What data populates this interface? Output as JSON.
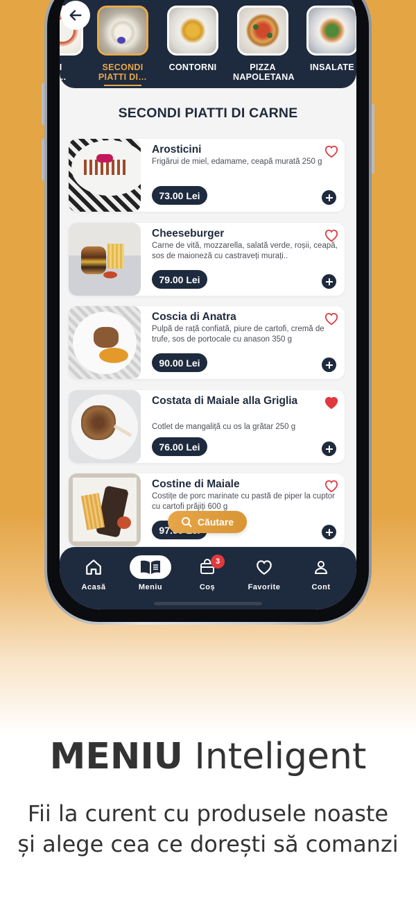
{
  "categories": [
    {
      "label": "DI\nDI…",
      "active": false
    },
    {
      "label": "SECONDI\nPIATTI DI…",
      "active": true
    },
    {
      "label": "CONTORNI",
      "active": false
    },
    {
      "label": "PIZZA\nNAPOLETANA",
      "active": false
    },
    {
      "label": "INSALATE",
      "active": false
    }
  ],
  "section_title": "SECONDI PIATTI DI CARNE",
  "products": [
    {
      "name": "Arosticini",
      "desc": "Frigărui de miel, edamame, ceapă murată 250 g",
      "price": "73.00 Lei",
      "favorite": false
    },
    {
      "name": "Cheeseburger",
      "desc": "Carne de vită, mozzarella, salată verde, roșii, ceapă, sos de maioneză cu castraveți murați..",
      "price": "79.00 Lei",
      "favorite": false
    },
    {
      "name": "Coscia di Anatra",
      "desc": "Pulpă de rață confiată, piure de cartofi, cremă de trufe, sos de portocale cu anason 350 g",
      "price": "90.00 Lei",
      "favorite": false
    },
    {
      "name": "Costata di Maiale alla Griglia",
      "desc": "Cotlet de mangaliță cu os la grătar 250 g",
      "price": "76.00 Lei",
      "favorite": true
    },
    {
      "name": "Costine di Maiale",
      "desc": "Costițe de porc marinate cu pastă de piper la cuptor cu cartofi prăjiți 600 g",
      "price": "97.00 Lei",
      "favorite": false
    }
  ],
  "search_label": "Căutare",
  "nav": [
    {
      "label": "Acasă",
      "icon": "home-icon"
    },
    {
      "label": "Meniu",
      "icon": "book-icon",
      "active": true
    },
    {
      "label": "Coș",
      "icon": "bag-icon",
      "badge": "3"
    },
    {
      "label": "Favorite",
      "icon": "heart-icon"
    },
    {
      "label": "Cont",
      "icon": "user-icon"
    }
  ],
  "promo": {
    "title_bold": "MENIU",
    "title_rest": "Inteligent",
    "subtitle_line1": "Fii la curent cu produsele noaste",
    "subtitle_line2": "și alege cea ce dorești să comanzi"
  },
  "colors": {
    "navy": "#1e2a3d",
    "accent": "#e8a94a",
    "heart": "#e03a3e"
  }
}
